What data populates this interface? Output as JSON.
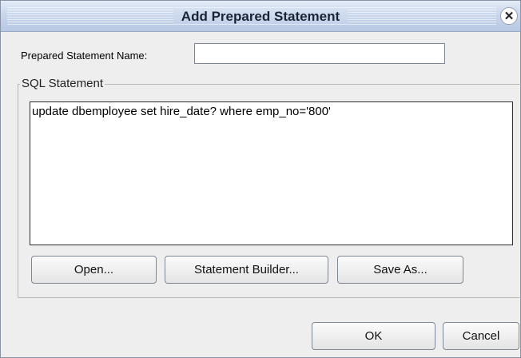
{
  "dialog": {
    "title": "Add Prepared Statement",
    "close_icon": "close-icon"
  },
  "name_field": {
    "label": "Prepared Statement Name:",
    "value": ""
  },
  "sql": {
    "group_label": "SQL Statement",
    "value": "update dbemployee set hire_date? where emp_no='800'"
  },
  "buttons": {
    "open": "Open...",
    "statement_builder": "Statement Builder...",
    "save_as": "Save As...",
    "ok": "OK",
    "cancel": "Cancel"
  }
}
